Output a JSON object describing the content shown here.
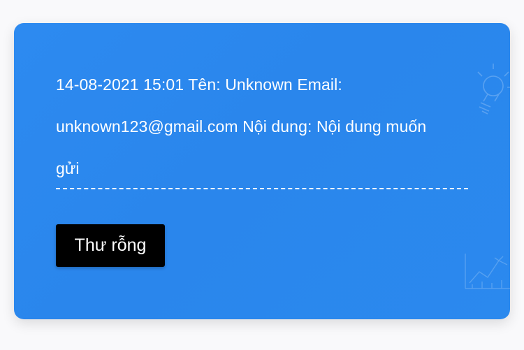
{
  "message": {
    "datetime": "14-08-2021 15:01",
    "name_label": "Tên:",
    "name_value": "Unknown",
    "email_label": "Email:",
    "email_value": "unknown123@gmail.com",
    "content_label": "Nội dung:",
    "content_value": "Nội dung muốn gửi"
  },
  "actions": {
    "clear_label": "Thư rỗng"
  },
  "colors": {
    "card_background": "#2b88ee",
    "page_background": "#f9f9fb",
    "button_background": "#000000",
    "text": "#ffffff"
  },
  "icons": {
    "top_right": "lightbulb-icon",
    "bottom_right": "chart-sketch-icon"
  }
}
